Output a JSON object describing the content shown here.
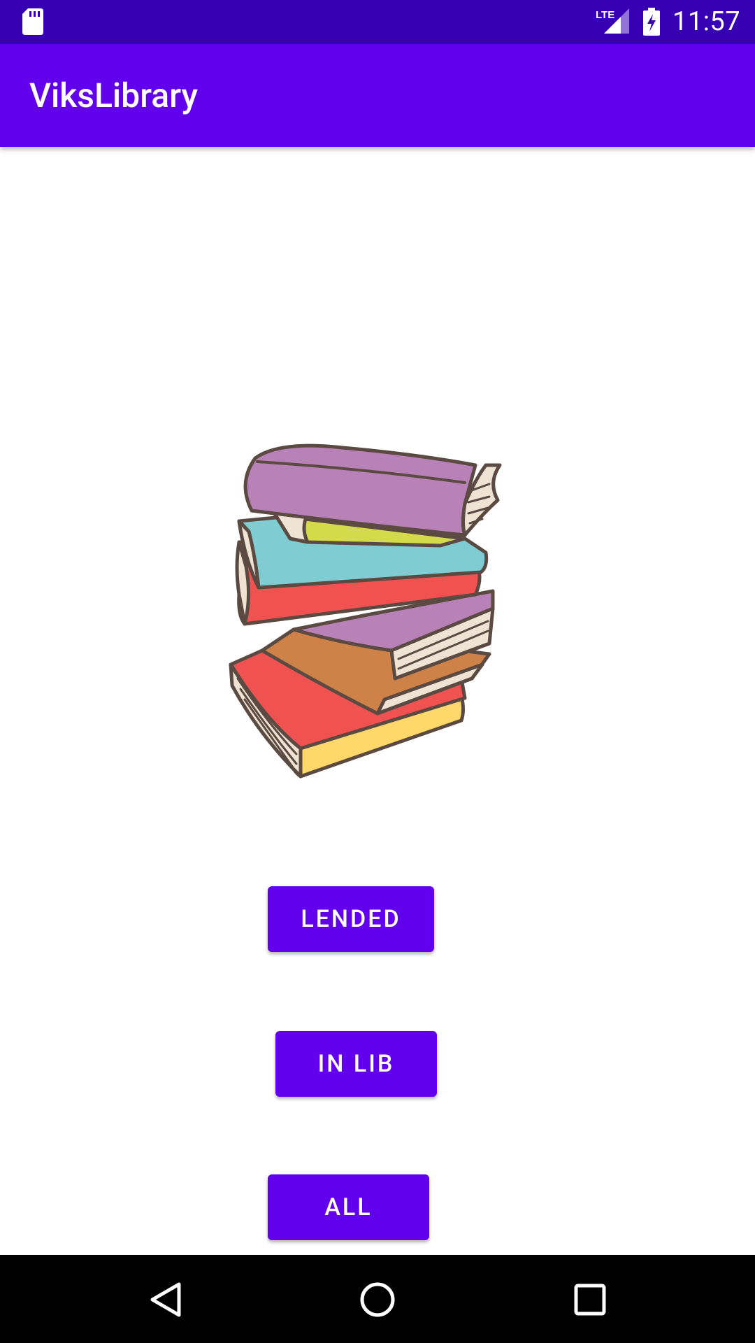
{
  "status_bar": {
    "time": "11:57",
    "network_label": "LTE",
    "icons": [
      "sd-card-icon",
      "lte-signal-icon",
      "battery-charging-icon"
    ]
  },
  "app_bar": {
    "title": "ViksLibrary"
  },
  "illustration": {
    "icon": "stack-of-books-illustration"
  },
  "buttons": {
    "lended": "LENDED",
    "in_lib": "IN LIB",
    "all": "ALL"
  },
  "nav_bar": {
    "icons": [
      "back-icon",
      "home-icon",
      "recents-icon"
    ]
  },
  "colors": {
    "primary": "#6200ee",
    "primary_dark": "#3700b3",
    "on_primary": "#ffffff",
    "background": "#ffffff",
    "nav_bar": "#000000"
  }
}
